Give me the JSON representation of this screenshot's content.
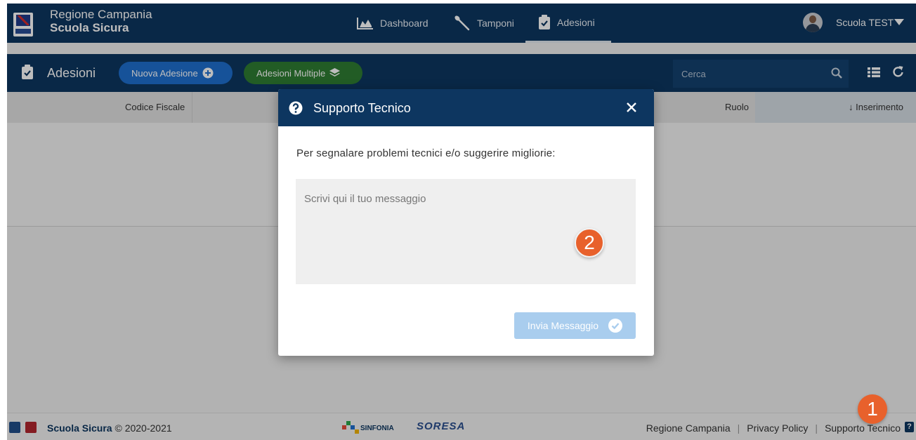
{
  "header": {
    "brand_line1": "Regione Campania",
    "brand_line2": "Scuola Sicura",
    "nav": [
      {
        "label": "Dashboard",
        "icon": "chart-area-icon"
      },
      {
        "label": "Tamponi",
        "icon": "swab-icon"
      },
      {
        "label": "Adesioni",
        "icon": "clipboard-check-icon",
        "active": true
      }
    ],
    "user": "Scuola TEST"
  },
  "toolbar": {
    "title": "Adesioni",
    "new_button": "Nuova Adesione",
    "multi_button": "Adesioni Multiple",
    "search_placeholder": "Cerca"
  },
  "table": {
    "columns": [
      "Codice Fiscale",
      "Ruolo",
      "↓ Inserimento"
    ]
  },
  "modal": {
    "title": "Supporto Tecnico",
    "label": "Per segnalare problemi tecnici e/o suggerire migliorie:",
    "placeholder": "Scrivi qui il tuo messaggio",
    "button": "Invia Messaggio"
  },
  "footer": {
    "brand": "Scuola Sicura",
    "copyright": "© 2020-2021",
    "partners": [
      "SINFONIA",
      "SORESA"
    ],
    "links": [
      "Regione Campania",
      "Privacy Policy",
      "Supporto Tecnico"
    ]
  },
  "badges": [
    "1",
    "2"
  ],
  "colors": {
    "navy": "#0d3660",
    "blue_button": "#1e6fcf",
    "green_button": "#2e7d32",
    "disabled_button": "#a9cdee",
    "badge": "#e8612c"
  }
}
